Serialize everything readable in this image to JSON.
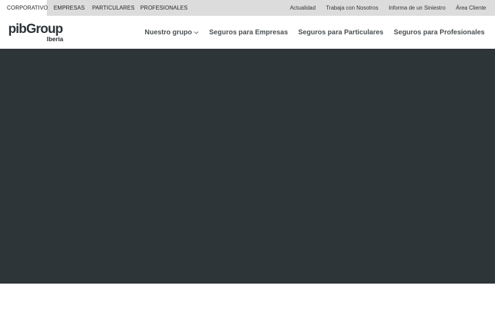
{
  "topbar": {
    "segments": [
      {
        "label": "CORPORATIVO",
        "active": true
      },
      {
        "label": "EMPRESAS",
        "active": false
      },
      {
        "label": "PARTICULARES",
        "active": false
      },
      {
        "label": "PROFESIONALES",
        "active": false
      }
    ],
    "utility": [
      "Actualidad",
      "Trabaja con Nosotros",
      "Informa de un Siniestro",
      "Área Cliente"
    ]
  },
  "header": {
    "logo_main": "pibGroup",
    "logo_sub": "Iberia",
    "nav": [
      {
        "label": "Nuestro grupo",
        "icon": "chevron-down-icon"
      },
      {
        "label": "Seguros para Empresas"
      },
      {
        "label": "Seguros para Particulares"
      },
      {
        "label": "Seguros para Profesionales"
      }
    ]
  },
  "colors": {
    "topbar_bg": "#dcdcdc",
    "hero_bg": "#2e3538",
    "brand_text": "#2c3236"
  }
}
